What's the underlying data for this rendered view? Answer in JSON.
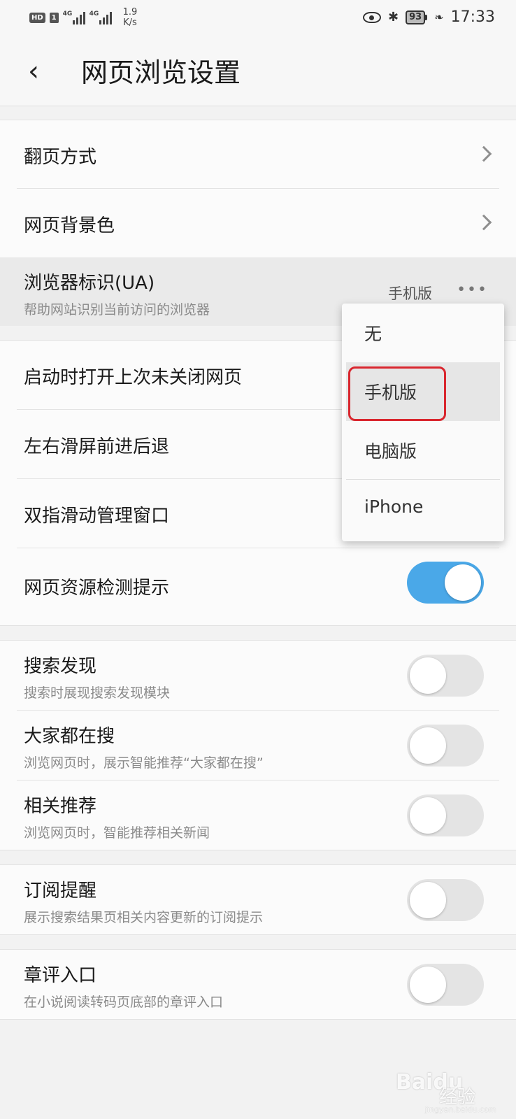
{
  "status_bar": {
    "hd": "HD",
    "sim": "1",
    "network1": "4G",
    "network2": "4G",
    "speed_value": "1.9",
    "speed_unit": "K/s",
    "battery": "93",
    "time": "17:33"
  },
  "header": {
    "back_icon": "‹",
    "title": "网页浏览设置"
  },
  "settings": {
    "page_turn": "翻页方式",
    "bg_color": "网页背景色",
    "ua_title": "浏览器标识(UA)",
    "ua_sub": "帮助网站识别当前访问的浏览器",
    "ua_value": "手机版",
    "ua_more": "•••",
    "restore_tabs": "启动时打开上次未关闭网页",
    "swipe_nav": "左右滑屏前进后退",
    "two_finger": "双指滑动管理窗口",
    "resource_hint": "网页资源检测提示",
    "resource_hint_on": true,
    "search_discover": "搜索发现",
    "search_discover_sub": "搜索时展现搜索发现模块",
    "search_discover_on": false,
    "everyone_search": "大家都在搜",
    "everyone_search_sub": "浏览网页时，展示智能推荐“大家都在搜”",
    "everyone_search_on": false,
    "related": "相关推荐",
    "related_sub": "浏览网页时，智能推荐相关新闻",
    "related_on": false,
    "subscribe": "订阅提醒",
    "subscribe_sub": "展示搜索结果页相关内容更新的订阅提示",
    "subscribe_on": false,
    "comment": "章评入口",
    "comment_sub": "在小说阅读转码页底部的章评入口",
    "comment_on": false
  },
  "dropdown": {
    "options": [
      "无",
      "手机版",
      "电脑版",
      "iPhone"
    ],
    "selected": "手机版"
  },
  "watermark": {
    "brand": "Baidu",
    "suffix": "经验",
    "url": "jingyan.baidu.com"
  },
  "colors": {
    "toggle_on": "#4aa8e8",
    "highlight_box": "#d9262e"
  }
}
